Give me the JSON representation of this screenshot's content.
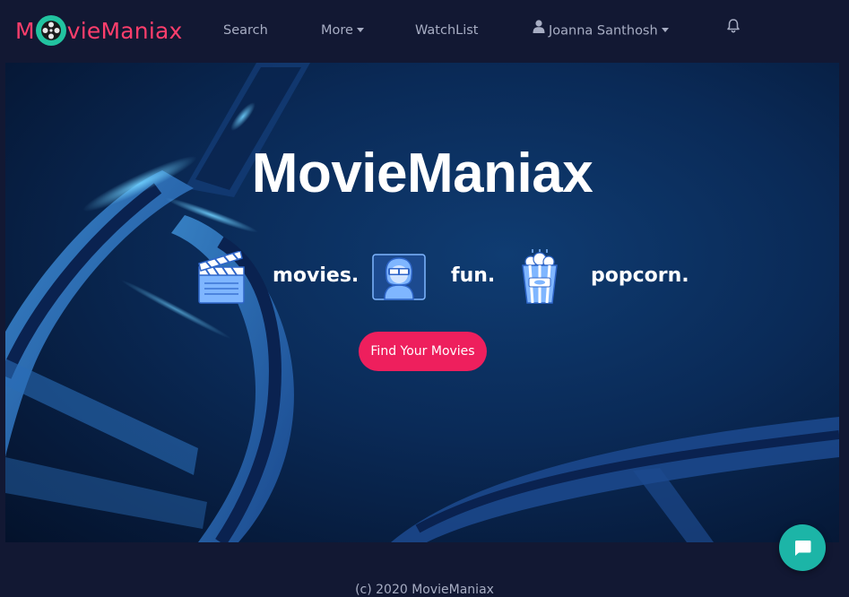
{
  "brand": {
    "name_prefix": "M",
    "name_suffix": "vieManiax",
    "color": "#ff3e6c",
    "reel_color": "#22c3a0"
  },
  "nav": {
    "items": [
      {
        "label": "Search"
      },
      {
        "label": "More",
        "icon": "caret-down-icon"
      },
      {
        "label": "WatchList"
      },
      {
        "label": "Joanna Santhosh",
        "icon": "user-icon"
      }
    ],
    "notification_icon": "bell-icon"
  },
  "hero": {
    "title": "MovieManiax",
    "features": [
      {
        "label": "movies.",
        "icon": "clapperboard-icon"
      },
      {
        "label": "fun.",
        "icon": "viewer-3d-glasses-icon"
      },
      {
        "label": "popcorn.",
        "icon": "popcorn-icon"
      }
    ],
    "cta_label": "Find Your Movies",
    "cta_color": "#ee1f5d"
  },
  "footer": {
    "copyright": "(c) 2020 MovieManiax"
  },
  "chat": {
    "icon": "chat-bubble-icon",
    "color": "#1cb5a7"
  },
  "colors": {
    "navbar_bg": "#121833",
    "nav_text": "#a7adc3",
    "hero_bg": "#0a2a57"
  }
}
